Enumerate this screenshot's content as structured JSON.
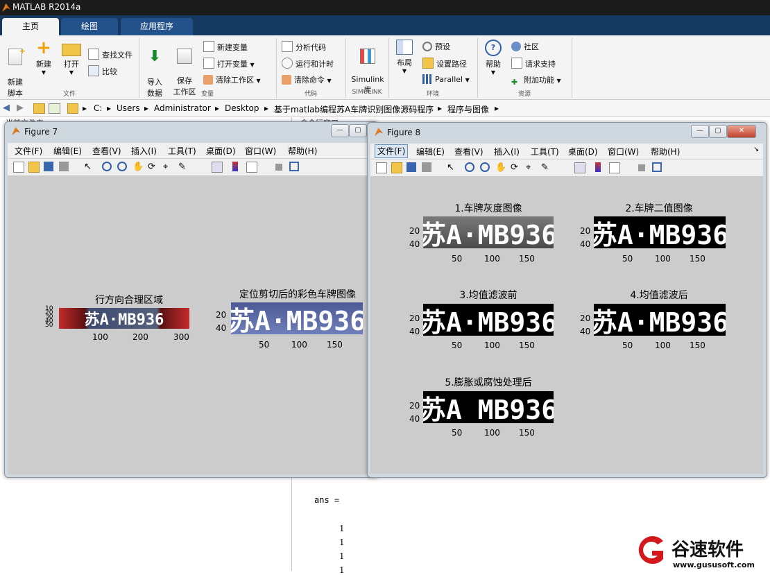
{
  "app": {
    "title": "MATLAB R2014a"
  },
  "tabs": [
    {
      "label": "主页",
      "active": true
    },
    {
      "label": "绘图",
      "active": false
    },
    {
      "label": "应用程序",
      "active": false
    }
  ],
  "ribbon": {
    "new_script": "新建\n脚本",
    "new": "新建",
    "open": "打开",
    "find_files": "查找文件",
    "compare": "比较",
    "import_data": "导入\n数据",
    "save_workspace": "保存\n工作区",
    "new_variable": "新建变量",
    "open_variable": "打开变量",
    "clear_workspace": "清除工作区",
    "analyze_code": "分析代码",
    "run_and_time": "运行和计时",
    "clear_commands": "清除命令",
    "simulink_library": "Simulink\n库",
    "layout": "布局",
    "preferences": "预设",
    "set_path": "设置路径",
    "parallel": "Parallel",
    "help": "帮助",
    "community": "社区",
    "request_support": "请求支持",
    "add_ons": "附加功能",
    "sections": {
      "file": "文件",
      "variable": "变量",
      "code": "代码",
      "simulink": "SIMULINK",
      "environment": "环境",
      "resources": "资源"
    }
  },
  "path": [
    "C:",
    "Users",
    "Administrator",
    "Desktop",
    "基于matlab编程苏A车牌识别图像源码程序",
    "程序与图像"
  ],
  "left_header": "当前文件夹",
  "cmd_header": "命令行窗口",
  "command_window": {
    "ans": "ans =",
    "values": [
      "1",
      "1",
      "1",
      "1"
    ]
  },
  "figure_menu": [
    "文件(F)",
    "编辑(E)",
    "查看(V)",
    "插入(I)",
    "工具(T)",
    "桌面(D)",
    "窗口(W)",
    "帮助(H)"
  ],
  "figure7": {
    "title": "Figure 7",
    "plots": [
      {
        "title": "行方向合理区域",
        "plate_text": "苏A·MB936",
        "yticks": [
          "10",
          "20",
          "30",
          "40",
          "50"
        ],
        "xticks": [
          "100",
          "200",
          "300"
        ]
      },
      {
        "title": "定位剪切后的彩色车牌图像",
        "plate_text": "苏A·MB936",
        "yticks": [
          "20",
          "40"
        ],
        "xticks": [
          "50",
          "100",
          "150"
        ]
      }
    ]
  },
  "figure8": {
    "title": "Figure 8",
    "plots": [
      {
        "title": "1.车牌灰度图像",
        "plate_text": "苏A·MB936",
        "yticks": [
          "20",
          "40"
        ],
        "xticks": [
          "50",
          "100",
          "150"
        ]
      },
      {
        "title": "2.车牌二值图像",
        "plate_text": "苏A·MB936",
        "yticks": [
          "20",
          "40"
        ],
        "xticks": [
          "50",
          "100",
          "150"
        ]
      },
      {
        "title": "3.均值滤波前",
        "plate_text": "苏A·MB936",
        "yticks": [
          "20",
          "40"
        ],
        "xticks": [
          "50",
          "100",
          "150"
        ]
      },
      {
        "title": "4.均值滤波后",
        "plate_text": "苏A·MB936",
        "yticks": [
          "20",
          "40"
        ],
        "xticks": [
          "50",
          "100",
          "150"
        ]
      },
      {
        "title": "5.膨胀或腐蚀处理后",
        "plate_text": "苏A MB936",
        "yticks": [
          "20",
          "40"
        ],
        "xticks": [
          "50",
          "100",
          "150"
        ]
      }
    ]
  },
  "watermark": {
    "brand": "谷速软件",
    "url": "www.gususoft.com"
  }
}
